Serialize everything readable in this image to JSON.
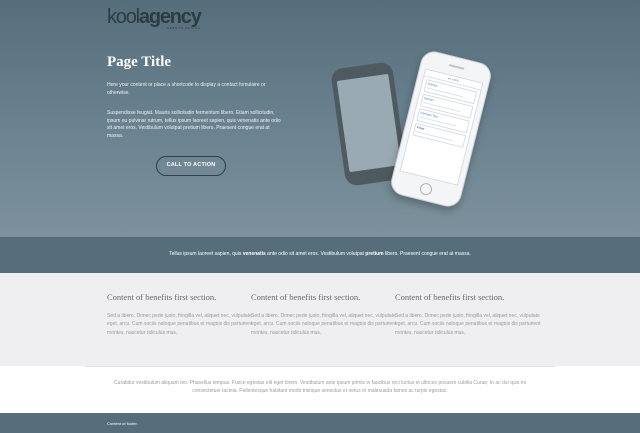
{
  "header": {
    "logo_light": "kool",
    "logo_bold": "agency",
    "logo_tagline": "WEBSITE DESIGN"
  },
  "hero": {
    "title": "Page Title",
    "intro": "Here your content or place a shortcode to display a contact fomulaire or otherwise.",
    "body": "Suspendisse feugiat. Mauris sollicitudin fermentum libero. Etiam sollicitudin, ipsum eu pulvinar rutrum, tellus ipsum laoreet sapien, quis venenatis ante odio sit amet eros. Vestibulum volutpat pretium libero. Praesent congue erat at massa.",
    "cta_label": "CALL TO ACTION"
  },
  "phone": {
    "app_title": "MY APPS",
    "cards": [
      "Interact",
      "Interact",
      "Interface Tool",
      "Projet"
    ]
  },
  "band": {
    "part1": "Tellus ipsum laoreet sapien, quis ",
    "bold1": "venenatis",
    "part2": " ante odio sit amet eros. Vestibulum volutpat ",
    "bold2": "pretium",
    "part3": " libero. Praesent congue erat at massa."
  },
  "benefits": [
    {
      "title": "Content of benefits first section.",
      "text": "Sed a libero. Donec pede justo, fringilla vel, aliquet nec, vulputate eget, arcu. Cum sociis natoque penatibus et magnis dis parturient montes, nascetur ridiculus mus."
    },
    {
      "title": "Content of benefits first section.",
      "text": "Sed a libero. Donec pede justo, fringilla vel, aliquet nec, vulputate eget, arcu. Cum sociis natoque penatibus et magnis dis parturient montes, nascetur ridiculus mus."
    },
    {
      "title": "Content of benefits first section.",
      "text": "Sed a libero. Donec pede justo, fringilla vel, aliquet nec, vulputate eget, arcu. Cum sociis natoque penatibus et magnis dis parturient montes, nascetur ridiculus mus."
    }
  ],
  "bottom_text": "Curabitur vestibulum aliquam leo. Phasellus tempus. Fusce egestas elit eget lorem. Vestibulum ante ipsum primis in faucibus orci luctus et ultrices posuere cubilia Curae; In ac dui quis mi consectetuer lacinia. Pellentesque habitant morbi tristique senectus et netus et malesuada fames ac turpis egestas.",
  "footer": {
    "text": "Content of footer."
  },
  "colors": {
    "hero_top": "#566e7b",
    "band": "#566e7b",
    "benefits_bg": "#efeff1",
    "cta_border": "#2f3e48"
  }
}
